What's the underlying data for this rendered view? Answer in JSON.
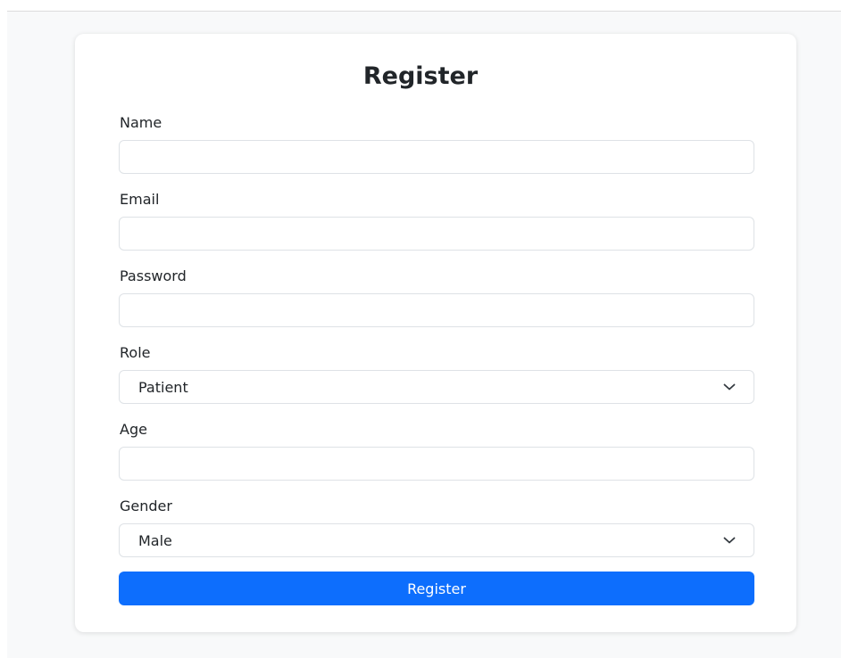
{
  "form": {
    "title": "Register",
    "fields": {
      "name": {
        "label": "Name",
        "value": "",
        "placeholder": ""
      },
      "email": {
        "label": "Email",
        "value": "",
        "placeholder": ""
      },
      "password": {
        "label": "Password",
        "value": "",
        "placeholder": ""
      },
      "role": {
        "label": "Role",
        "selected": "Patient",
        "icon": "chevron-down-icon"
      },
      "age": {
        "label": "Age",
        "value": "",
        "placeholder": ""
      },
      "gender": {
        "label": "Gender",
        "selected": "Male",
        "icon": "chevron-down-icon"
      }
    },
    "submit_label": "Register"
  },
  "colors": {
    "primary": "#0d6efd",
    "page_background": "#f8f9fa",
    "card_background": "#ffffff",
    "input_border": "#dee2e6"
  }
}
